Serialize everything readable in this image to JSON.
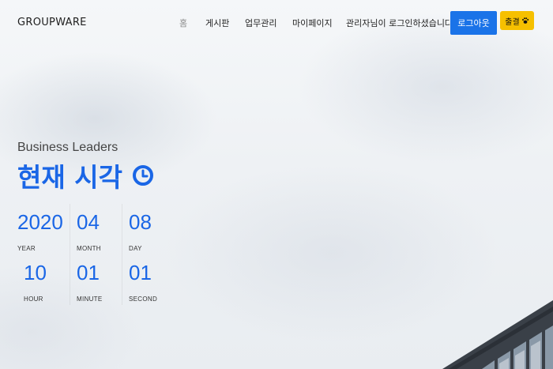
{
  "brand": "GROUPWARE",
  "nav": {
    "items": [
      {
        "label": "홈"
      },
      {
        "label": "게시판"
      },
      {
        "label": "업무관리"
      },
      {
        "label": "마이페이지"
      }
    ],
    "welcome": "관리자님이 로그인하셨습니다.",
    "logout_label": "로그아웃",
    "checkin_label": "출결",
    "checkin_icon": "paw-icon"
  },
  "hero": {
    "subtitle": "Business Leaders",
    "title": "현재 시각",
    "title_icon": "clock-icon"
  },
  "clock": {
    "year": {
      "value": "2020",
      "unit": "YEAR"
    },
    "month": {
      "value": "04",
      "unit": "MONTH"
    },
    "day": {
      "value": "08",
      "unit": "DAY"
    },
    "hour": {
      "value": "10",
      "unit": "HOUR"
    },
    "minute": {
      "value": "01",
      "unit": "MINUTE"
    },
    "second": {
      "value": "01",
      "unit": "SECOND"
    }
  },
  "colors": {
    "accent": "#1a66e6",
    "logout_button": "#1a73e8",
    "checkin_button": "#f6c000"
  }
}
